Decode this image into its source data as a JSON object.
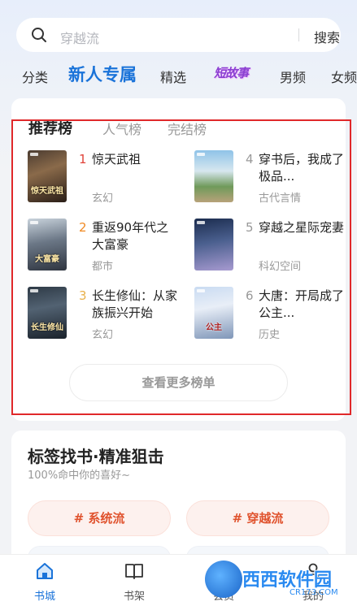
{
  "search": {
    "placeholder": "穿越流",
    "button_label": "搜索"
  },
  "category_tabs": [
    {
      "label": "分类"
    },
    {
      "label": "新人专属",
      "active": true
    },
    {
      "label": "精选"
    },
    {
      "label": "短故事"
    },
    {
      "label": "男频"
    },
    {
      "label": "女频"
    }
  ],
  "ranking": {
    "tabs": [
      {
        "label": "推荐榜",
        "active": true
      },
      {
        "label": "人气榜"
      },
      {
        "label": "完结榜"
      }
    ],
    "books": [
      {
        "rank": "1",
        "title": "惊天武祖",
        "genre": "玄幻",
        "rank_color": "#e0433a",
        "cover_text": "惊天武祖"
      },
      {
        "rank": "2",
        "title": "重返90年代之大富豪",
        "genre": "都市",
        "rank_color": "#f08a24",
        "cover_text": "大富豪"
      },
      {
        "rank": "3",
        "title": "长生修仙：从家族振兴开始",
        "genre": "玄幻",
        "rank_color": "#e8b04a",
        "cover_text": "长生修仙"
      },
      {
        "rank": "4",
        "title": "穿书后，我成了极品...",
        "genre": "古代言情",
        "rank_color": "#999999",
        "cover_text": ""
      },
      {
        "rank": "5",
        "title": "穿越之星际宠妻",
        "genre": "科幻空间",
        "rank_color": "#999999",
        "cover_text": ""
      },
      {
        "rank": "6",
        "title": "大唐：开局成了公主...",
        "genre": "历史",
        "rank_color": "#999999",
        "cover_text": "公主"
      }
    ],
    "more_label": "查看更多榜单"
  },
  "tags_section": {
    "title": "标签找书·精准狙击",
    "subtitle": "100%命中你的喜好~",
    "tags": [
      {
        "label": "# 系统流"
      },
      {
        "label": "# 穿越流"
      }
    ]
  },
  "bottom_nav": [
    {
      "label": "书城",
      "icon": "home-icon",
      "active": true
    },
    {
      "label": "书架",
      "icon": "book-icon"
    },
    {
      "label": "会员",
      "icon": "vip-icon"
    },
    {
      "label": "我的",
      "icon": "profile-icon"
    }
  ],
  "watermark": {
    "text": "西西软件园",
    "sub": "CR173.COM"
  },
  "colors": {
    "accent": "#1a73d9",
    "highlight_border": "#e0282a",
    "tag_text": "#e0532e"
  }
}
